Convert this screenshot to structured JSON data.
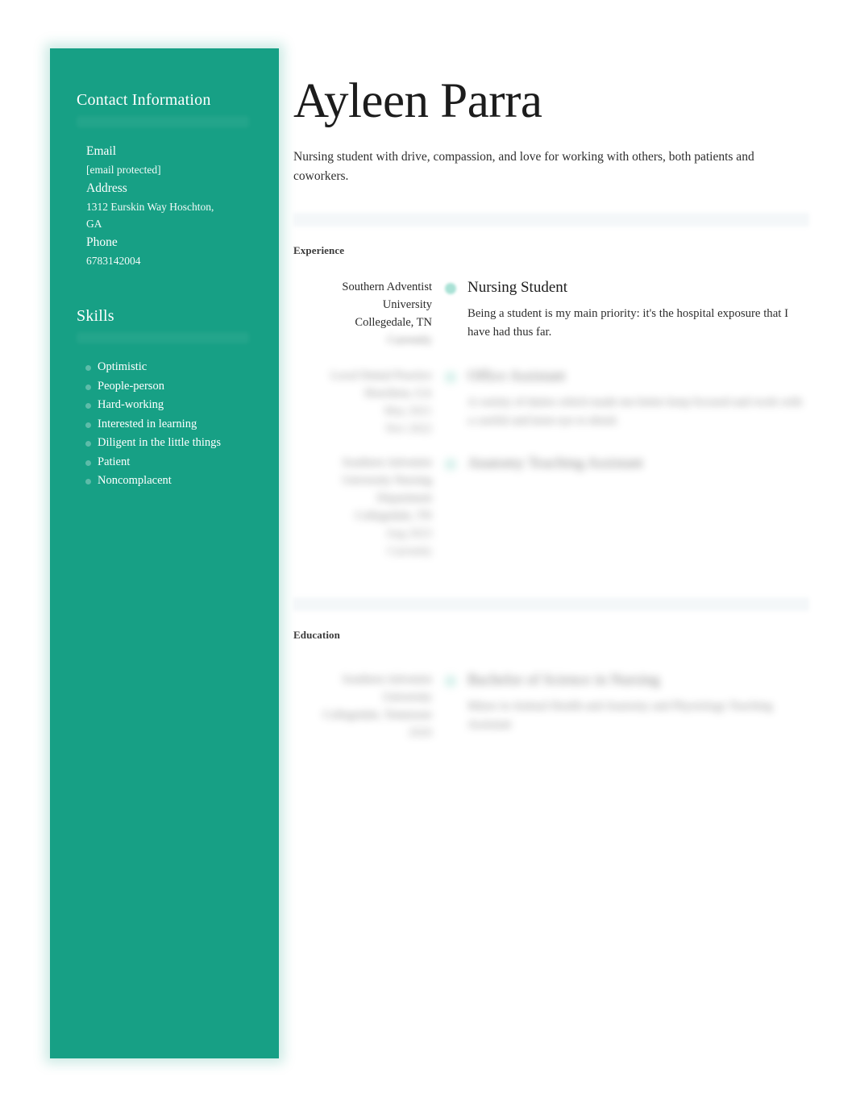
{
  "sidebar": {
    "contact": {
      "heading": "Contact Information",
      "fields": [
        {
          "label": "Email",
          "value": "[email protected]"
        },
        {
          "label": "Address",
          "value": "1312 Eurskin Way Hoschton,",
          "value2": "GA"
        },
        {
          "label": "Phone",
          "value": "6783142004"
        }
      ]
    },
    "skills": {
      "heading": "Skills",
      "items": [
        "Optimistic",
        "People-person",
        "Hard-working",
        "Interested in learning",
        "Diligent in the little things",
        "Patient",
        "Noncomplacent"
      ]
    }
  },
  "main": {
    "name": "Ayleen Parra",
    "summary": "Nursing student with drive, compassion, and love for working with others, both patients and coworkers.",
    "experience": {
      "title": "Experience",
      "entries": [
        {
          "org": "Southern Adventist",
          "org2": "University",
          "location": "Collegedale, TN",
          "date": "Currently",
          "role": "Nursing Student",
          "description": "Being a student is my main priority: it's the hospital exposure that I have had thus far.",
          "redacted": false
        },
        {
          "org": "Local Dental Practice",
          "org2": "",
          "location": "Hoschton, GA",
          "date": "May 2021",
          "date2": "Nov 2022",
          "role": "Office Assistant",
          "description": "A variety of duties which made me better keep focused and work with a careful and keen eye to detail.",
          "redacted": true
        },
        {
          "org": "Southern Adventist",
          "org2": "University Nursing",
          "org3": "Department",
          "location": "Collegedale, TN",
          "date": "Aug 2023",
          "date2": "Currently",
          "role": "Anatomy Teaching Assistant",
          "description": "",
          "redacted": true
        }
      ]
    },
    "education": {
      "title": "Education",
      "entries": [
        {
          "org": "Southern Adventist",
          "org2": "University",
          "location": "Collegedale, Tennessee",
          "date": "2026",
          "degree": "Bachelor of Science in Nursing",
          "description": "Minor in Animal Health and Anatomy and Physiology Teaching Assistant",
          "redacted": true
        }
      ]
    }
  },
  "colors": {
    "sidebar_teal": "#17a085",
    "marker_teal": "#63c9b3",
    "text_dark": "#1c1c1c",
    "page_background": "#ffffff"
  }
}
